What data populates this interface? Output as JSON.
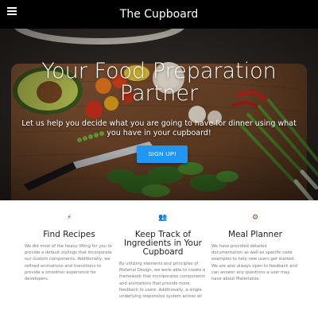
{
  "navbar": {
    "brand": "The Cupboard",
    "menu_icon": "hamburger-menu-icon"
  },
  "hero": {
    "title": "Your Food Preparation Partner",
    "subtitle": "Let us help you decide what you are going to have for dinner using what you have in your cupboard!",
    "button_label": "SIGN UP!",
    "button_color": "#2196f3"
  },
  "features": [
    {
      "icon": "flash-icon",
      "icon_glyph": "⚡",
      "title": "Find Recipes",
      "text": "We did most of the heavy lifting for you to provide a default stylings that incorporate our custom components. Additionally, we refined animations and transitions to provide a smoother experience for developers."
    },
    {
      "icon": "group-icon",
      "icon_glyph": "👥",
      "title": "Keep Track of Ingredients in Your Cupboard",
      "text": "By utilizing elements and principles of Material Design, we were able to create a framework that incorporates components and animations that provide more feedback to users. Additionally, a single underlying responsive system across all"
    },
    {
      "icon": "settings-icon",
      "icon_glyph": "⚙",
      "title": "Meal Planner",
      "text": "We have provided detailed documentation as well as specific code examples to help new users get started. We are also always open to feedback and can answer any questions a user may have about Materialize."
    }
  ],
  "colors": {
    "navbar_bg": "#000000",
    "icon_accent": "#8a3c1a"
  }
}
